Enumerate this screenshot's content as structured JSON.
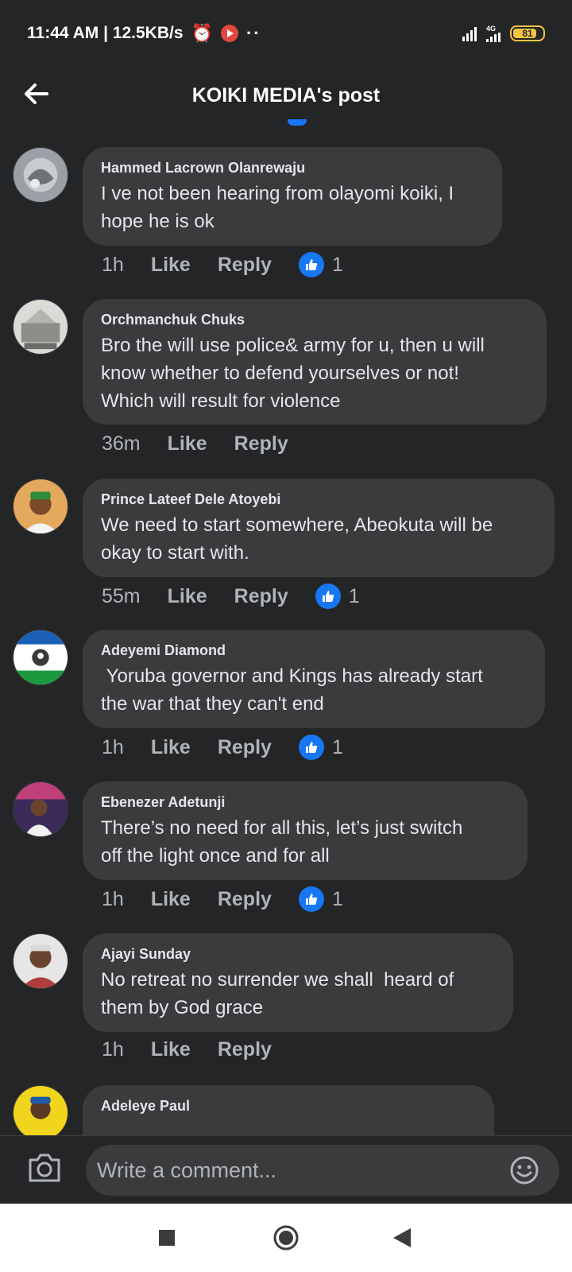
{
  "status_bar": {
    "time_speed": "11:44 AM | 12.5KB/s",
    "network": "4G",
    "battery": "81",
    "battery_level": 0.81
  },
  "header": {
    "title": "KOIKI MEDIA's post"
  },
  "comments": [
    {
      "author": "Hammed Lacrown Olanrewaju",
      "text": "I ve not been hearing from olayomi koiki, I\nhope he is ok",
      "time": "1h",
      "like_label": "Like",
      "reply_label": "Reply",
      "reactions": "1"
    },
    {
      "author": "Orchmanchuk Chuks",
      "text": "Bro the will use police& army for u, then u will\nknow whether to defend yourselves or not!\nWhich will result for violence",
      "time": "36m",
      "like_label": "Like",
      "reply_label": "Reply",
      "reactions": ""
    },
    {
      "author": "Prince Lateef Dele Atoyebi",
      "text": "We need to start somewhere, Abeokuta will be\nokay to start with.",
      "time": "55m",
      "like_label": "Like",
      "reply_label": "Reply",
      "reactions": "1"
    },
    {
      "author": "Adeyemi Diamond",
      "text": " Yoruba governor and Kings has already start\nthe war that they can't end",
      "time": "1h",
      "like_label": "Like",
      "reply_label": "Reply",
      "reactions": "1"
    },
    {
      "author": "Ebenezer Adetunji",
      "text": "There’s no need for all this, let’s just switch\noff the light once and for all",
      "time": "1h",
      "like_label": "Like",
      "reply_label": "Reply",
      "reactions": "1"
    },
    {
      "author": "Ajayi Sunday",
      "text": "No retreat no surrender we shall  heard of\nthem by God grace",
      "time": "1h",
      "like_label": "Like",
      "reply_label": "Reply",
      "reactions": ""
    },
    {
      "author": "Adeleye Paul",
      "text": "",
      "time": "",
      "like_label": "",
      "reply_label": "",
      "reactions": ""
    }
  ],
  "composer": {
    "placeholder": "Write a comment..."
  },
  "icons": {
    "back": "arrow-left-icon",
    "camera": "camera-icon",
    "emoji": "smiley-icon",
    "like_reaction": "thumbs-up-icon",
    "nav_recents": "square-icon",
    "nav_home": "circle-icon",
    "nav_back": "triangle-back-icon"
  },
  "colors": {
    "background": "#242526",
    "bubble": "#3a3b3c",
    "accent": "#1877f2",
    "battery": "#f5c542"
  }
}
